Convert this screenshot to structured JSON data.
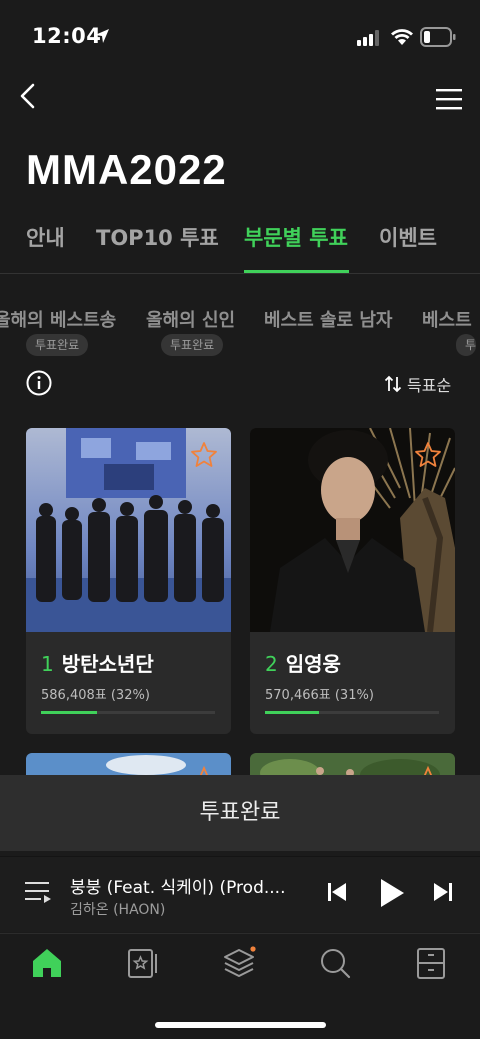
{
  "status_bar": {
    "time": "12:04"
  },
  "header": {
    "title": "MMA2022"
  },
  "tabs": [
    {
      "label": "안내"
    },
    {
      "label": "TOP10 투표"
    },
    {
      "label": "부문별 투표"
    },
    {
      "label": "이벤트"
    }
  ],
  "subcategories": [
    {
      "label": "올해의 베스트송",
      "badge": "투표완료"
    },
    {
      "label": "올해의 신인",
      "badge": "투표완료"
    },
    {
      "label": "베스트 솔로 남자",
      "badge": ""
    },
    {
      "label": "베스트",
      "badge": "투"
    }
  ],
  "toolbar": {
    "sort_label": "득표순"
  },
  "candidates": [
    {
      "rank": "1",
      "name": "방탄소년단",
      "votes": "586,408표 (32%)",
      "share": 0.32
    },
    {
      "rank": "2",
      "name": "임영웅",
      "votes": "570,466표 (31%)",
      "share": 0.31
    }
  ],
  "vote_button": {
    "label": "투표완료"
  },
  "player": {
    "title": "붕붕 (Feat. 식케이) (Prod....",
    "artist": "김하온 (HAON)"
  },
  "colors": {
    "accent": "#40d15a",
    "star": "#f0823c",
    "background": "#1b1b1b"
  },
  "icons": {
    "nav": [
      "home-icon",
      "starred-playlist-icon",
      "layers-icon",
      "search-icon",
      "library-icon"
    ]
  }
}
